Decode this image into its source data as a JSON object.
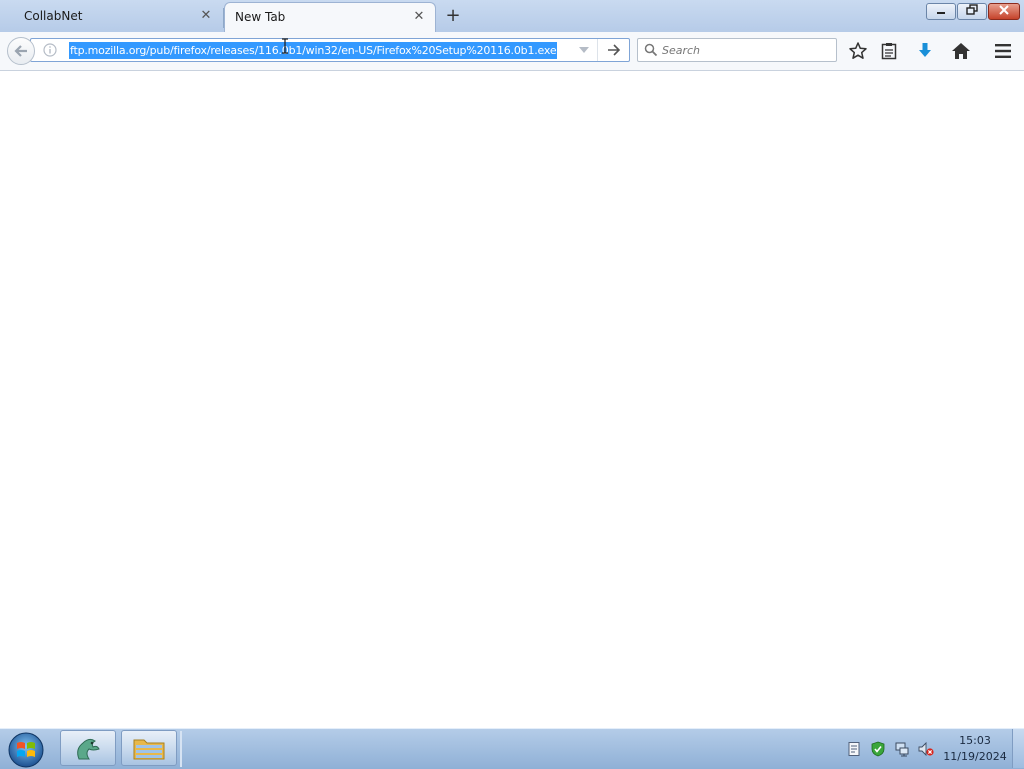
{
  "browser": {
    "tabs": [
      {
        "label": "CollabNet",
        "active": false
      },
      {
        "label": "New Tab",
        "active": true
      }
    ],
    "new_tab_label": "+",
    "window_controls": {
      "minimize": "—",
      "restore": "❐",
      "close": "✕"
    }
  },
  "navbar": {
    "url": "ftp.mozilla.org/pub/firefox/releases/116.0b1/win32/en-US/Firefox%20Setup%20116.0b1.exe",
    "url_selected": true,
    "search_placeholder": "Search"
  },
  "icons": {
    "back": "back-arrow-icon",
    "info": "info-icon",
    "dropdown": "chevron-down-icon",
    "go": "go-arrow-icon",
    "search": "search-icon",
    "bookmark": "star-icon",
    "reading_list": "clipboard-icon",
    "downloads": "download-arrow-icon",
    "home": "home-icon",
    "menu": "hamburger-menu-icon"
  },
  "colors": {
    "selection": "#3399ff",
    "download_accent": "#1a8fd8",
    "tab_strip": "#c9daf0",
    "taskbar": "#9fbde0"
  },
  "taskbar": {
    "clock_time": "15:03",
    "clock_date": "11/19/2024"
  }
}
